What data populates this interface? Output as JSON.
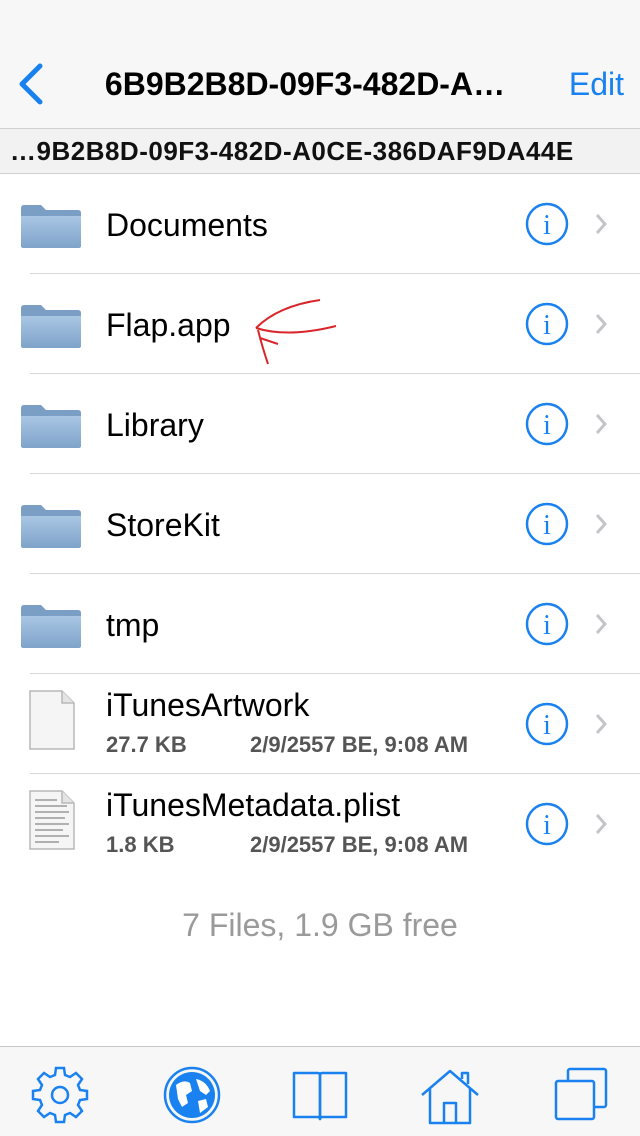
{
  "nav": {
    "title": "6B9B2B8D-09F3-482D-A…",
    "edit_label": "Edit"
  },
  "path": "…9B2B8D-09F3-482D-A0CE-386DAF9DA44E",
  "items": [
    {
      "name": "Documents",
      "type": "folder"
    },
    {
      "name": "Flap.app",
      "type": "folder"
    },
    {
      "name": "Library",
      "type": "folder"
    },
    {
      "name": "StoreKit",
      "type": "folder"
    },
    {
      "name": "tmp",
      "type": "folder"
    },
    {
      "name": "iTunesArtwork",
      "type": "file",
      "size": "27.7 KB",
      "date": "2/9/2557 BE, 9:08 AM"
    },
    {
      "name": "iTunesMetadata.plist",
      "type": "text-file",
      "size": "1.8 KB",
      "date": "2/9/2557 BE, 9:08 AM"
    }
  ],
  "summary": "7 Files, 1.9 GB free",
  "tabs": [
    "settings-gear-icon",
    "globe-icon",
    "book-icon",
    "home-icon",
    "windows-icon"
  ],
  "colors": {
    "accent": "#1a82f0",
    "folder": "#8fb2d4",
    "annotation": "#d9262b"
  }
}
